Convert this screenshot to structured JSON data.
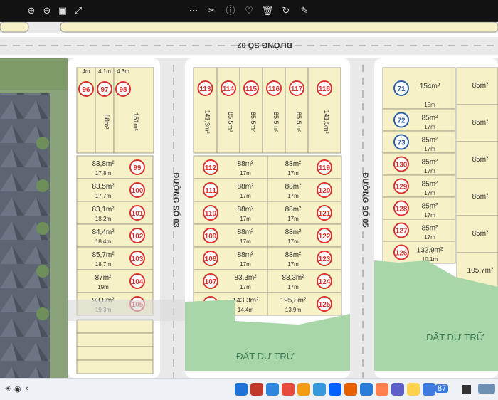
{
  "toolbar": {
    "icons": [
      "zoom-in-icon",
      "zoom-out-icon",
      "fit-screen-icon",
      "expand-icon",
      "more-icon",
      "crop-icon",
      "info-icon",
      "heart-icon",
      "delete-icon",
      "rotate-icon",
      "edit-icon"
    ]
  },
  "map": {
    "roads": {
      "top": "ĐƯỜNG SỐ 02",
      "left": "ĐƯỜNG SỐ 03",
      "right": "ĐƯỜNG SỐ 05"
    },
    "reserved_label": "ĐẤT DỰ TRỮ",
    "colors": {
      "lot_fill": "#f6f1c6",
      "lot_border": "#8c8c7a",
      "road": "#e9e9e9",
      "sidewalk": "#ffffff",
      "reserved": "#a9d6a9",
      "circle": "#d8322e",
      "circle_blue": "#2d5fa8"
    },
    "top_lots": [
      {
        "num": "96",
        "area": "",
        "w": "4m"
      },
      {
        "num": "97",
        "area": "88m²",
        "w": "4.1m"
      },
      {
        "num": "98",
        "area": "151m²",
        "w": "4.3m"
      }
    ],
    "col1_lots": [
      {
        "num": "99",
        "area": "83,8m²",
        "w": "17,8m"
      },
      {
        "num": "100",
        "area": "83,5m²",
        "w": "17,7m"
      },
      {
        "num": "101",
        "area": "83,1m²",
        "w": "18,2m"
      },
      {
        "num": "102",
        "area": "84,4m²",
        "w": "18,4m"
      },
      {
        "num": "103",
        "area": "85,7m²",
        "w": "18,7m"
      },
      {
        "num": "104",
        "area": "87m²",
        "w": "19m"
      },
      {
        "num": "105",
        "area": "93,8m²",
        "w": "19,3m"
      }
    ],
    "mid_top_lots": [
      {
        "num": "113",
        "area": "141,3m²"
      },
      {
        "num": "114",
        "area": "85,5m²"
      },
      {
        "num": "115",
        "area": "85,5m²"
      },
      {
        "num": "116",
        "area": "85,5m²"
      },
      {
        "num": "117",
        "area": "85,5m²"
      },
      {
        "num": "118",
        "area": "141,5m²"
      }
    ],
    "mid_left_lots": [
      {
        "num": "112",
        "area": "88m²",
        "w": "17m"
      },
      {
        "num": "111",
        "area": "88m²",
        "w": "17m"
      },
      {
        "num": "110",
        "area": "88m²",
        "w": "17m"
      },
      {
        "num": "109",
        "area": "88m²",
        "w": "17m"
      },
      {
        "num": "108",
        "area": "88m²",
        "w": "17m"
      },
      {
        "num": "107",
        "area": "83,3m²",
        "w": "17m"
      },
      {
        "num": "106",
        "area": "143,3m²",
        "w": "14,4m"
      }
    ],
    "mid_right_lots": [
      {
        "num": "119",
        "area": "88m²",
        "w": "17m"
      },
      {
        "num": "120",
        "area": "88m²",
        "w": "17m"
      },
      {
        "num": "121",
        "area": "88m²",
        "w": "17m"
      },
      {
        "num": "122",
        "area": "88m²",
        "w": "17m"
      },
      {
        "num": "123",
        "area": "88m²",
        "w": "17m"
      },
      {
        "num": "124",
        "area": "83,3m²",
        "w": "17m"
      },
      {
        "num": "125",
        "area": "195,8m²",
        "w": "13,9m"
      }
    ],
    "right_lots": [
      {
        "num": "71",
        "area": "154m²",
        "w": "15m",
        "blue": true
      },
      {
        "num": "72",
        "area": "85m²",
        "w": "17m",
        "blue": true
      },
      {
        "num": "73",
        "area": "85m²",
        "w": "17m",
        "blue": true
      },
      {
        "num": "130",
        "area": "85m²",
        "w": "17m",
        "blue": false
      },
      {
        "num": "129",
        "area": "85m²",
        "w": "17m",
        "blue": false
      },
      {
        "num": "128",
        "area": "85m²",
        "w": "17m",
        "blue": false
      },
      {
        "num": "127",
        "area": "85m²",
        "w": "17m",
        "blue": false
      },
      {
        "num": "126",
        "area": "132,9m²",
        "w": "10,1m",
        "blue": false
      }
    ],
    "far_right_areas": [
      "85m²",
      "85m²",
      "85m²",
      "85m²",
      "85m²",
      "105,7m²"
    ]
  },
  "taskbar": {
    "apps": [
      "start",
      "widgets",
      "search",
      "file-explorer",
      "chrome",
      "store",
      "dropbox",
      "firefox",
      "edge",
      "paint",
      "teams",
      "notes",
      "phone-link"
    ],
    "tray_badge": "87"
  }
}
